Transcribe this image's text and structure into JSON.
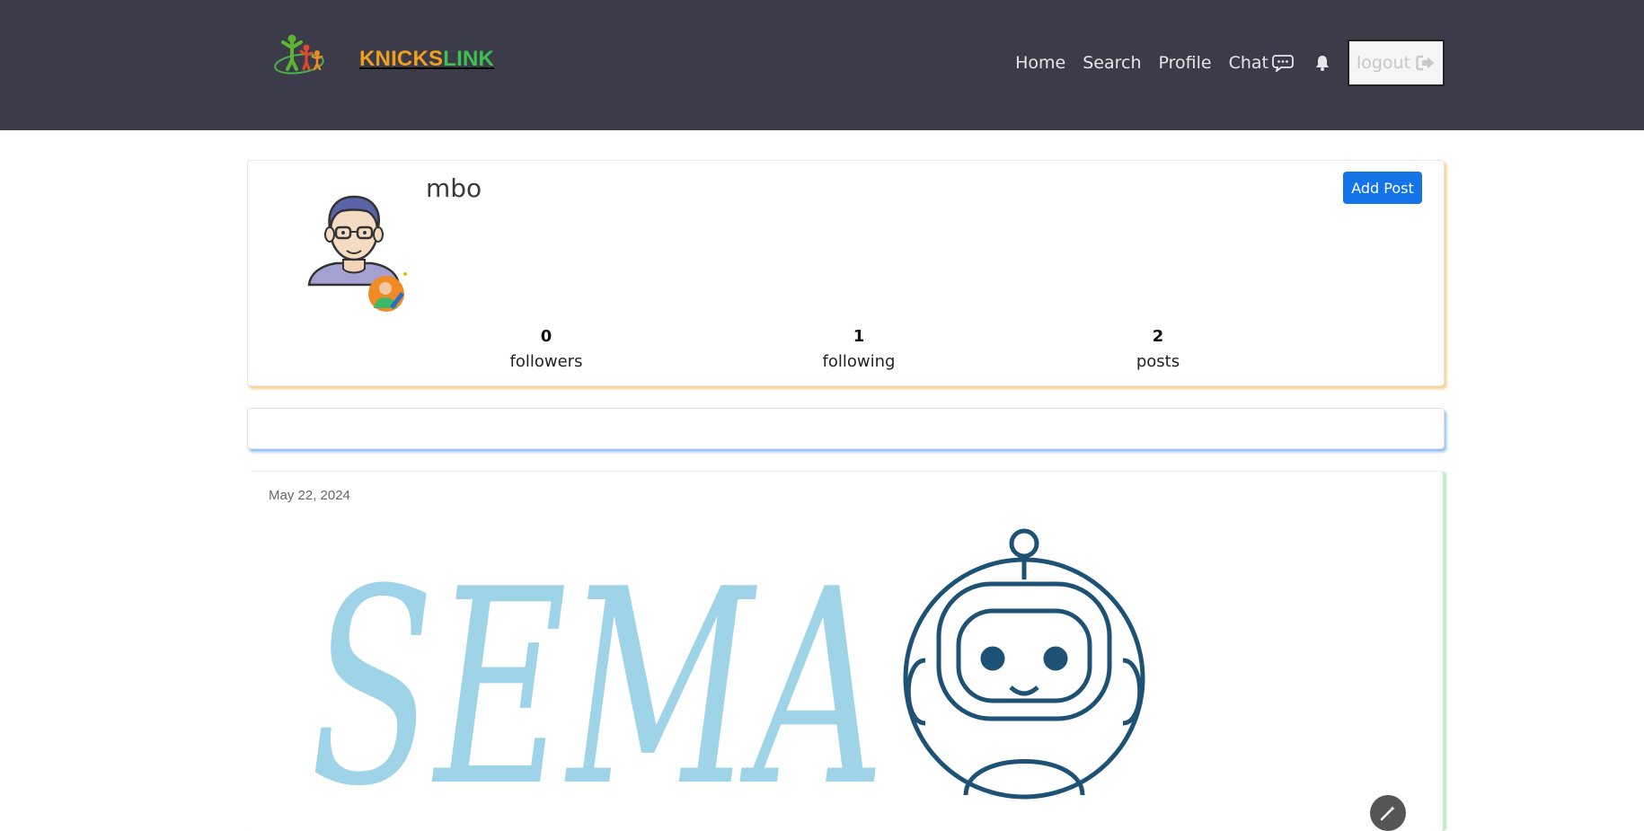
{
  "brand": {
    "part1": "KNICKS",
    "part2": "LINK",
    "color1": "#f0a01a",
    "color2": "#3cc24f"
  },
  "nav": {
    "home": "Home",
    "search": "Search",
    "profile": "Profile",
    "chat": "Chat",
    "logout": "logout"
  },
  "profile": {
    "username": "mbo",
    "add_post_label": "Add Post",
    "stats": [
      {
        "value": "0",
        "label": "followers"
      },
      {
        "value": "1",
        "label": "following"
      },
      {
        "value": "2",
        "label": "posts"
      }
    ]
  },
  "post": {
    "date": "May 22, 2024",
    "image_text": "SEMA"
  },
  "colors": {
    "header_bg": "#3b3b4a",
    "accent_blue": "#1473e6",
    "card_shadow_orange": "#f5d39a",
    "bar_shadow_blue": "#8bbcf0",
    "post_border_green": "#c6eec6"
  },
  "icons": [
    "family-logo-icon",
    "chat-bubble-icon",
    "bell-icon",
    "logout-arrow-icon",
    "avatar-icon",
    "edit-avatar-icon",
    "robot-icon",
    "magic-wand-icon"
  ]
}
